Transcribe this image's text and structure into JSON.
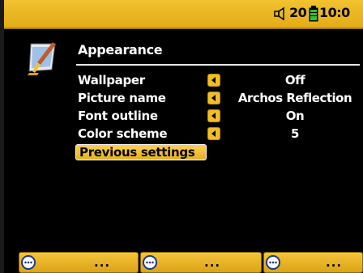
{
  "status": {
    "volume": "20",
    "time": "10:0",
    "icons": [
      "speaker-icon",
      "battery-icon"
    ]
  },
  "section": {
    "title": "Appearance",
    "icon": "paint-brush-icon"
  },
  "settings": [
    {
      "label": "Wallpaper",
      "value": "Off"
    },
    {
      "label": "Picture name",
      "value": "Archos Reflection"
    },
    {
      "label": "Font outline",
      "value": "On"
    },
    {
      "label": "Color scheme",
      "value": "5"
    }
  ],
  "previous_button": "Previous settings",
  "softkeys": [
    {
      "label": "...",
      "icon": "menu-icon"
    },
    {
      "label": "...",
      "icon": "menu-icon"
    },
    {
      "label": "...",
      "icon": "menu-icon"
    }
  ],
  "colors": {
    "accent": "#f0be2a",
    "background": "#000000",
    "text": "#ffffff"
  }
}
